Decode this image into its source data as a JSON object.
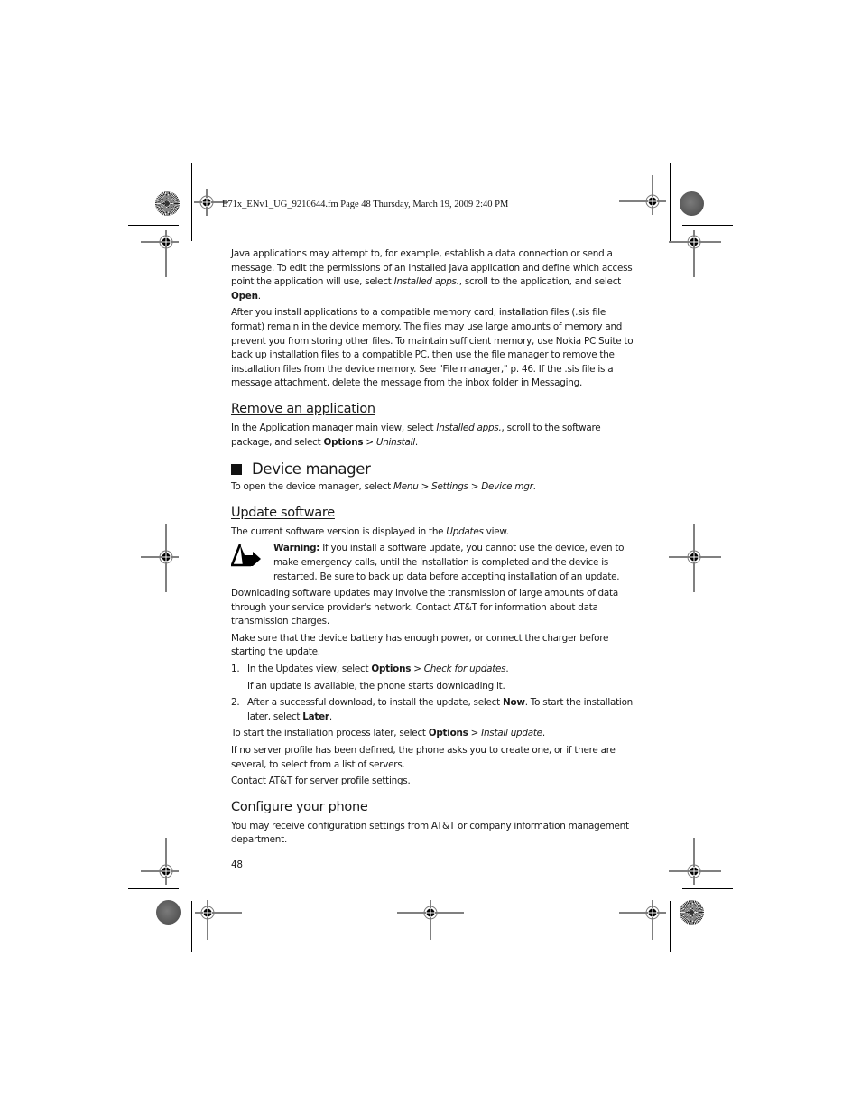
{
  "slug": "E71x_ENv1_UG_9210644.fm  Page 48  Thursday, March 19, 2009  2:40 PM",
  "intro": {
    "p1": {
      "pre": "Java applications may attempt to, for example, establish a data connection or send a message. To edit the permissions of an installed Java application and define which access point the application will use, select ",
      "i1": "Installed apps.",
      "mid": ", scroll to the application, and select ",
      "b1": "Open",
      "post": "."
    },
    "p2": "After you install applications to a compatible memory card, installation files (.sis file format) remain in the device memory. The files may use large amounts of memory and prevent you from storing other files. To maintain sufficient memory, use Nokia PC Suite to back up installation files to a compatible PC, then use the file manager to remove the installation files from the device memory. See \"File manager,\" p. 46. If the .sis file is a message attachment, delete the message from the inbox folder in Messaging."
  },
  "remove": {
    "heading": "Remove an application",
    "p": {
      "pre": "In the Application manager main view, select ",
      "i1": "Installed apps.",
      "mid": ", scroll to the software package, and select ",
      "b1": "Options",
      "sep": " > ",
      "i2": "Uninstall",
      "post": "."
    }
  },
  "device_manager": {
    "heading": "Device manager",
    "p": {
      "pre": "To open the device manager, select ",
      "i1": "Menu",
      "sep1": " > ",
      "i2": "Settings",
      "sep2": " > ",
      "i3": "Device mgr",
      "post": "."
    }
  },
  "update": {
    "heading": "Update software",
    "p1": {
      "pre": "The current software version is displayed in the ",
      "i1": "Updates",
      "post": " view."
    },
    "warning": {
      "label": "Warning:",
      "text": " If you install a software update, you cannot use the device, even to make emergency calls, until the installation is completed and the device is restarted. Be sure to back up data before accepting installation of an update."
    },
    "p2": "Downloading software updates may involve the transmission of large amounts of data through your service provider's network. Contact AT&T for information about data transmission charges.",
    "p3": "Make sure that the device battery has enough power, or connect the charger before starting the update.",
    "steps": [
      {
        "num": "1.",
        "pre": "In the Updates view, select ",
        "b1": "Options",
        "sep": " > ",
        "i1": "Check for updates",
        "post": ".",
        "sub": "If an update is available, the phone starts downloading it."
      },
      {
        "num": "2.",
        "pre": "After a successful download, to install the update, select ",
        "b1": "Now",
        "mid": ". To start the installation later, select ",
        "b2": "Later",
        "post": "."
      }
    ],
    "p4": {
      "pre": "To start the installation process later, select ",
      "b1": "Options",
      "sep": " > ",
      "i1": "Install update",
      "post": "."
    },
    "p5": "If no server profile has been defined, the phone asks you to create one, or if there are several, to select from a list of servers.",
    "p6": "Contact AT&T for server profile settings."
  },
  "configure": {
    "heading": "Configure your phone",
    "p": "You may receive configuration settings from AT&T or company information management department."
  },
  "page_number": "48"
}
